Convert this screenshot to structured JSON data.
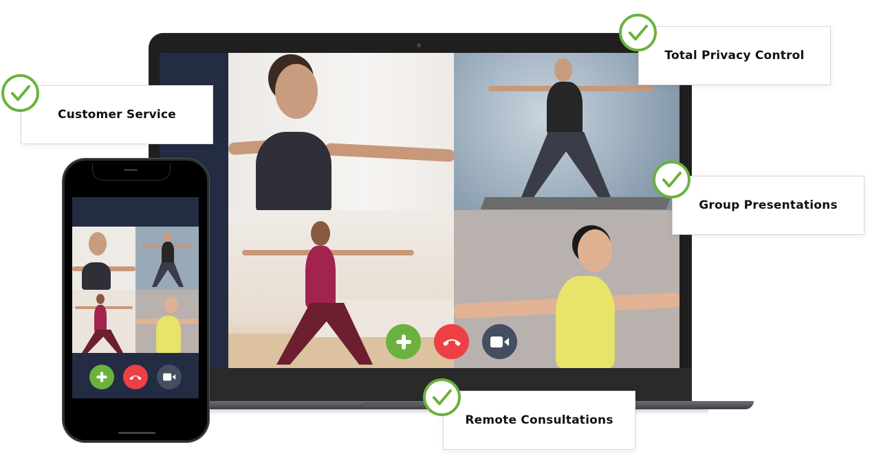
{
  "callouts": [
    {
      "id": "customer-service",
      "label": "Customer Service"
    },
    {
      "id": "total-privacy-control",
      "label": "Total Privacy Control"
    },
    {
      "id": "group-presentations",
      "label": "Group Presentations"
    },
    {
      "id": "remote-consultations",
      "label": "Remote Consultations"
    }
  ],
  "call_controls": {
    "add": {
      "icon": "plus-icon",
      "color": "#6ab23d"
    },
    "end": {
      "icon": "phone-hangup-icon",
      "color": "#ee4044"
    },
    "video": {
      "icon": "video-camera-icon",
      "color": "#454d60"
    }
  },
  "participants": [
    {
      "name": "participant-1",
      "shirt_color": "#2f2f38",
      "bg": "light-studio"
    },
    {
      "name": "participant-2",
      "shirt_color": "#262626",
      "bg": "blue-grey-wall"
    },
    {
      "name": "participant-3",
      "shirt_color": "#a3234f",
      "bg": "bedroom"
    },
    {
      "name": "participant-4",
      "shirt_color": "#e8e36a",
      "bg": "grey-wall"
    }
  ],
  "colors": {
    "accent_green": "#6ab23d",
    "end_red": "#ee4044",
    "video_slate": "#454d60",
    "screen_navy": "#232c42"
  }
}
